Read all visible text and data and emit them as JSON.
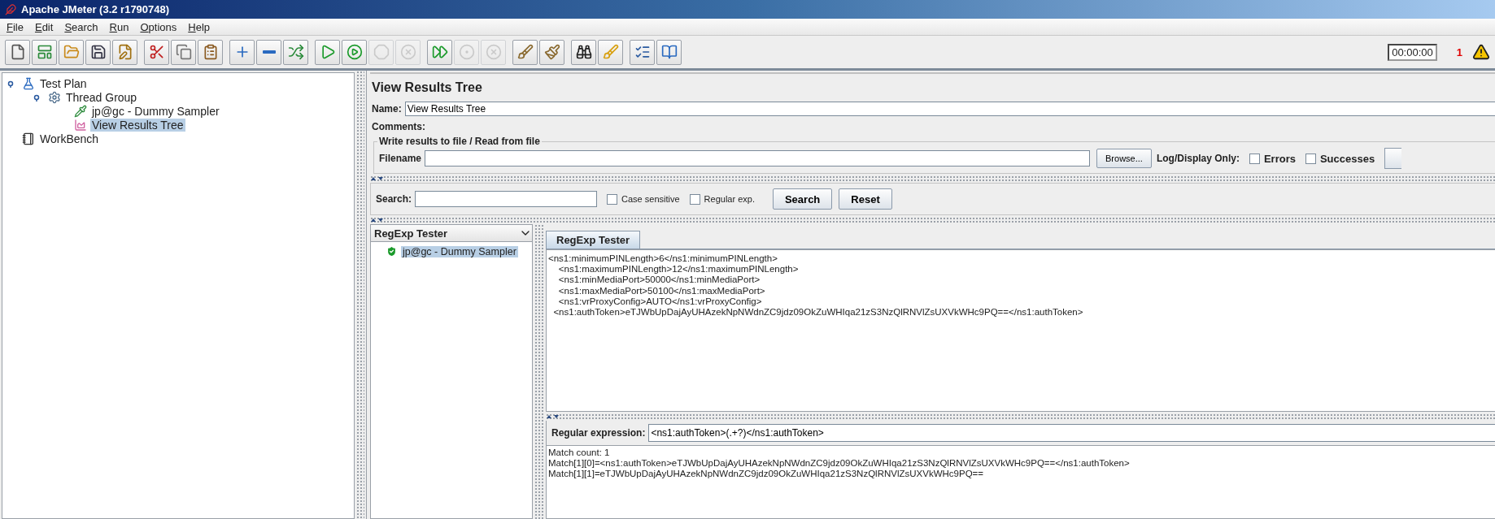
{
  "window": {
    "title": "Apache JMeter (3.2 r1790748)"
  },
  "menu": [
    "File",
    "Edit",
    "Search",
    "Run",
    "Options",
    "Help"
  ],
  "toolbar": [
    [
      {
        "kind": "new",
        "disabled": false
      },
      {
        "kind": "templates",
        "disabled": false
      },
      {
        "kind": "open",
        "disabled": false
      },
      {
        "kind": "save",
        "disabled": false
      },
      {
        "kind": "save-as",
        "disabled": false
      }
    ],
    [
      {
        "kind": "cut",
        "disabled": false
      },
      {
        "kind": "copy",
        "disabled": false
      },
      {
        "kind": "paste",
        "disabled": false
      }
    ],
    [
      {
        "kind": "expand",
        "disabled": false
      },
      {
        "kind": "collapse",
        "disabled": false
      },
      {
        "kind": "toggle",
        "disabled": false
      }
    ],
    [
      {
        "kind": "start",
        "disabled": false
      },
      {
        "kind": "start-no-pause",
        "disabled": false
      },
      {
        "kind": "stop",
        "disabled": true
      },
      {
        "kind": "shutdown",
        "disabled": true
      }
    ],
    [
      {
        "kind": "remote-start",
        "disabled": false
      },
      {
        "kind": "remote-stop",
        "disabled": true
      },
      {
        "kind": "remote-exit",
        "disabled": true
      }
    ],
    [
      {
        "kind": "clear",
        "disabled": false
      },
      {
        "kind": "clear-all",
        "disabled": false
      }
    ],
    [
      {
        "kind": "search",
        "disabled": false
      },
      {
        "kind": "reset-search",
        "disabled": false
      }
    ],
    [
      {
        "kind": "functions",
        "disabled": false
      },
      {
        "kind": "help",
        "disabled": false
      }
    ]
  ],
  "timer": "00:00:00",
  "warning_count": "1",
  "tree": [
    {
      "label": "Test Plan",
      "kind": "plan",
      "selected": false,
      "expanded": true,
      "children": [
        {
          "label": "Thread Group",
          "kind": "threads",
          "selected": false,
          "expanded": true,
          "children": [
            {
              "label": "jp@gc - Dummy Sampler",
              "kind": "sampler",
              "selected": false
            },
            {
              "label": "View Results Tree",
              "kind": "listener",
              "selected": true
            }
          ]
        }
      ]
    },
    {
      "label": "WorkBench",
      "kind": "workbench",
      "selected": false
    }
  ],
  "panel": {
    "title": "View Results Tree",
    "name_label": "Name:",
    "name_value": "View Results Tree",
    "comments_label": "Comments:",
    "file_group": {
      "title": "Write results to file / Read from file",
      "filename_label": "Filename",
      "browse": "Browse...",
      "log_label": "Log/Display Only:",
      "checkboxes": [
        {
          "label": "Errors",
          "checked": false
        },
        {
          "label": "Successes",
          "checked": false
        }
      ]
    },
    "search": {
      "label": "Search:",
      "checkboxes": [
        {
          "label": "Case sensitive",
          "checked": false
        },
        {
          "label": "Regular exp.",
          "checked": false
        }
      ],
      "buttons": [
        "Search",
        "Reset"
      ]
    },
    "renderer": "RegExp Tester",
    "results": [
      {
        "label": "jp@gc - Dummy Sampler",
        "selected": true
      }
    ],
    "tabs": [
      {
        "label": "RegExp Tester",
        "selected": true
      }
    ],
    "response_lines": [
      "<ns1:minimumPINLength>6</ns1:minimumPINLength>",
      "    <ns1:maximumPINLength>12</ns1:maximumPINLength>",
      "    <ns1:minMediaPort>50000</ns1:minMediaPort>",
      "    <ns1:maxMediaPort>50100</ns1:maxMediaPort>",
      "    <ns1:vrProxyConfig>AUTO</ns1:vrProxyConfig>",
      "  <ns1:authToken>eTJWbUpDajAyUHAzekNpNWdnZC9jdz09OkZuWHIqa21zS3NzQlRNVlZsUXVkWHc9PQ==</ns1:authToken>"
    ],
    "regex": {
      "label": "Regular expression:",
      "value": "<ns1:authToken>(.+?)</ns1:authToken>"
    },
    "result_lines": [
      "Match count: 1",
      "Match[1][0]=<ns1:authToken>eTJWbUpDajAyUHAzekNpNWdnZC9jdz09OkZuWHIqa21zS3NzQlRNVlZsUXVkWHc9PQ==</ns1:authToken>",
      "Match[1][1]=eTJWbUpDajAyUHAzekNpNWdnZC9jdz09OkZuWHIqa21zS3NzQlRNVlZsUXVkWHc9PQ=="
    ]
  }
}
